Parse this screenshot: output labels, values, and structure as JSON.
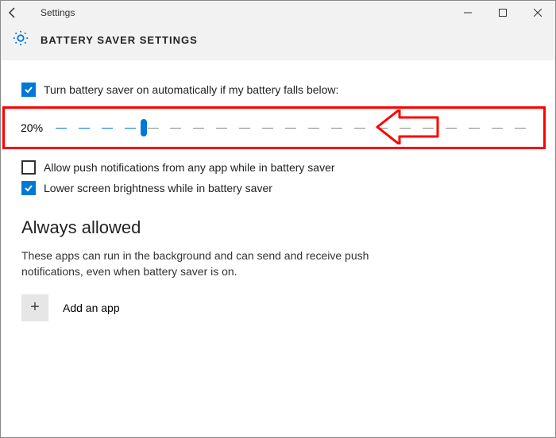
{
  "titlebar": {
    "app_name": "Settings"
  },
  "header": {
    "page_title": "BATTERY SAVER SETTINGS"
  },
  "options": {
    "auto_on_label": "Turn battery saver on automatically if my battery falls below:",
    "allow_push_label": "Allow push notifications from any app while in battery saver",
    "lower_brightness_label": "Lower screen brightness while in battery saver"
  },
  "slider": {
    "value_label": "20%",
    "value": 20,
    "min": 0,
    "max": 100
  },
  "always_allowed": {
    "heading": "Always allowed",
    "description": "These apps can run in the background and can send and receive push notifications, even when battery saver is on.",
    "add_label": "Add an app"
  },
  "annotation": {
    "highlight_color": "#ff0000"
  }
}
